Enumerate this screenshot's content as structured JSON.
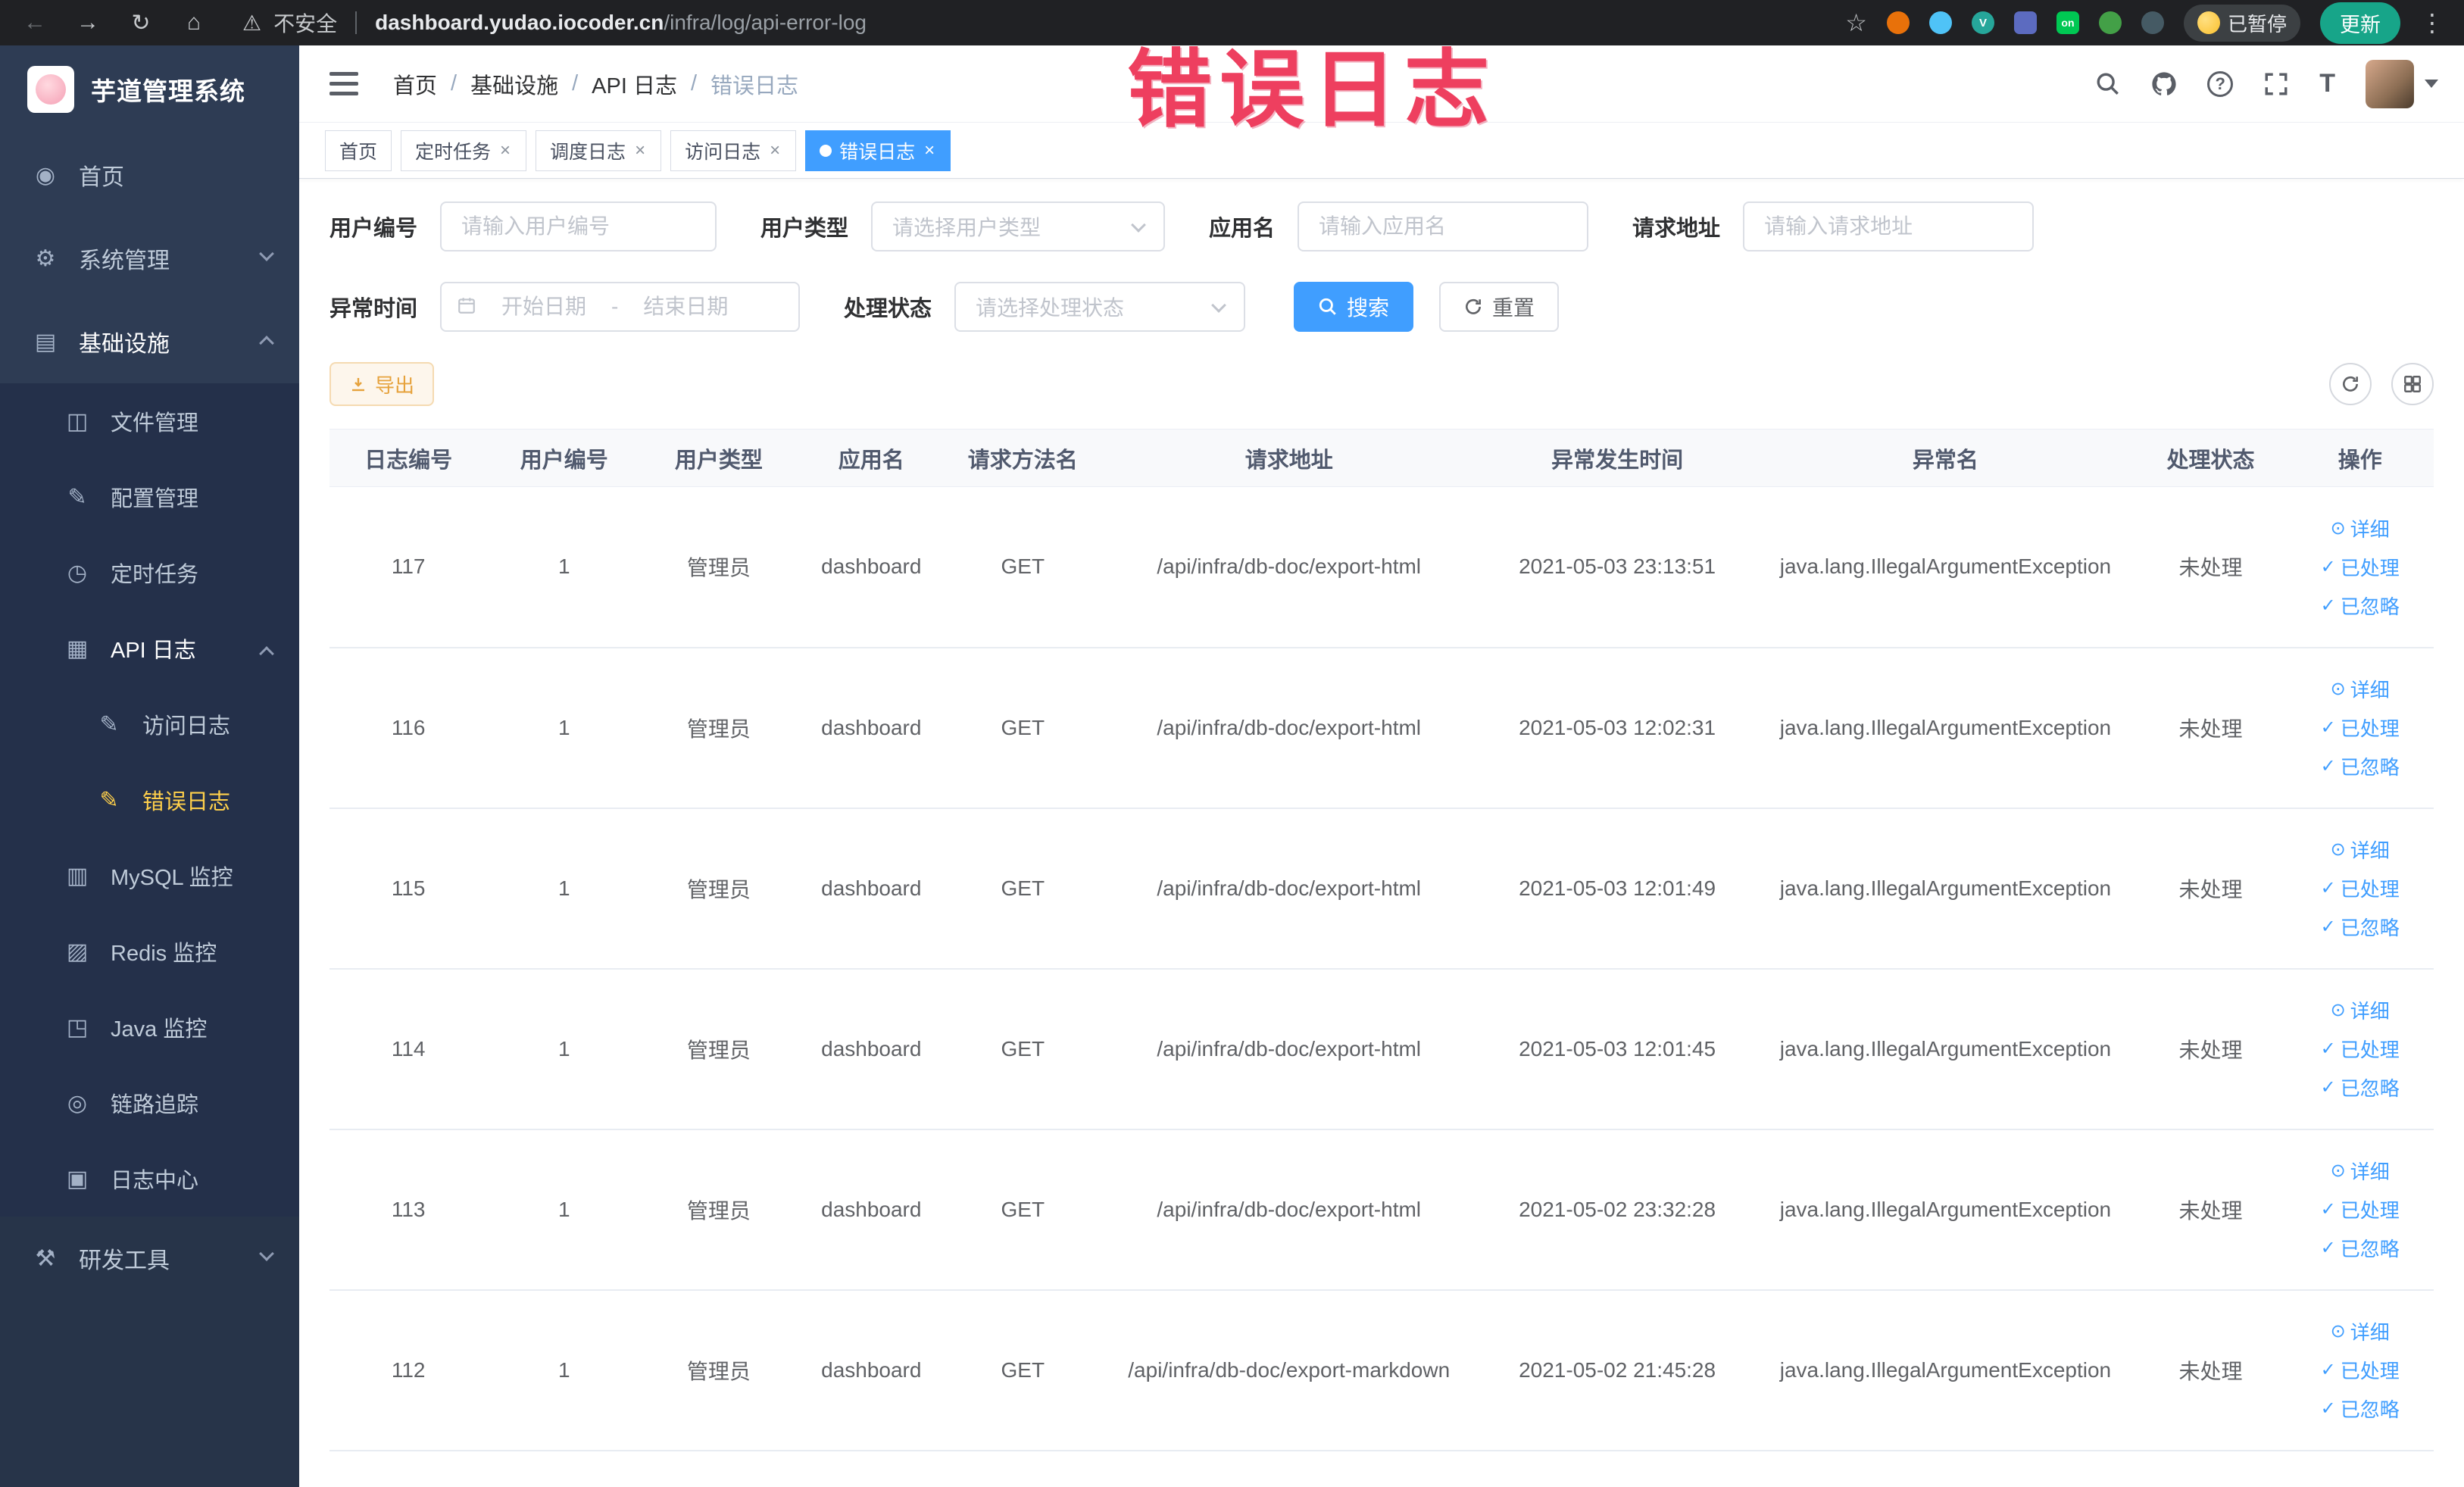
{
  "colors": {
    "accent": "#409EFF",
    "warning": "#e6a23c",
    "sidebar_active": "#ffd04b",
    "annotation": "#ee3f5f",
    "tag_active_bg": "#409EFF"
  },
  "icons": {
    "back": "←",
    "forward": "→",
    "reload": "↻",
    "browser_home": "⌂",
    "warning": "⚠",
    "star": "☆",
    "kebab": "⋮",
    "question": "?",
    "text_size": "T",
    "ext_v": "V",
    "ext_on": "on",
    "home": "◉",
    "system": "⚙",
    "infra": "▤",
    "file": "◫",
    "config": "✎",
    "job": "◷",
    "api_log": "▦",
    "access_log": "✎",
    "error_log": "✎",
    "mysql": "▥",
    "redis": "▨",
    "java": "◳",
    "trace": "◎",
    "log_center": "▣",
    "dev_tools": "⚒",
    "eye": "⊙",
    "check": "✓",
    "range_sep": "-"
  },
  "browser": {
    "security_label": "不安全",
    "url_domain": "dashboard.yudao.iocoder.cn",
    "url_path": "/infra/log/api-error-log",
    "paused_label": "已暂停",
    "update_label": "更新"
  },
  "annotation": {
    "text": "错误日志"
  },
  "sidebar": {
    "logo_title": "芋道管理系统",
    "items": {
      "home": "首页",
      "system": "系统管理",
      "infra": "基础设施",
      "file": "文件管理",
      "config": "配置管理",
      "job": "定时任务",
      "api_log": "API 日志",
      "access_log": "访问日志",
      "error_log": "错误日志",
      "mysql": "MySQL 监控",
      "redis": "Redis 监控",
      "java": "Java 监控",
      "trace": "链路追踪",
      "log_center": "日志中心",
      "dev_tools": "研发工具"
    }
  },
  "breadcrumb": {
    "items": [
      "首页",
      "基础设施",
      "API 日志",
      "错误日志"
    ]
  },
  "tabs": [
    {
      "label": "首页"
    },
    {
      "label": "定时任务"
    },
    {
      "label": "调度日志"
    },
    {
      "label": "访问日志"
    },
    {
      "label": "错误日志"
    }
  ],
  "filters": {
    "user_id": {
      "label": "用户编号",
      "placeholder": "请输入用户编号"
    },
    "user_type": {
      "label": "用户类型",
      "placeholder": "请选择用户类型"
    },
    "app_name": {
      "label": "应用名",
      "placeholder": "请输入应用名"
    },
    "request_url": {
      "label": "请求地址",
      "placeholder": "请输入请求地址"
    },
    "exception_time": {
      "label": "异常时间",
      "start_placeholder": "开始日期",
      "end_placeholder": "结束日期"
    },
    "process_status": {
      "label": "处理状态",
      "placeholder": "请选择处理状态"
    },
    "search_button": "搜索",
    "reset_button": "重置"
  },
  "toolbar": {
    "export_button": "导出"
  },
  "table": {
    "columns": [
      "日志编号",
      "用户编号",
      "用户类型",
      "应用名",
      "请求方法名",
      "请求地址",
      "异常发生时间",
      "异常名",
      "处理状态",
      "操作"
    ],
    "actions": {
      "detail": "详细",
      "processed": "已处理",
      "ignored": "已忽略"
    },
    "rows": [
      {
        "id": "117",
        "user_id": "1",
        "user_type": "管理员",
        "app": "dashboard",
        "method": "GET",
        "url": "/api/infra/db-doc/export-html",
        "time": "2021-05-03 23:13:51",
        "exception": "java.lang.IllegalArgumentException",
        "status": "未处理"
      },
      {
        "id": "116",
        "user_id": "1",
        "user_type": "管理员",
        "app": "dashboard",
        "method": "GET",
        "url": "/api/infra/db-doc/export-html",
        "time": "2021-05-03 12:02:31",
        "exception": "java.lang.IllegalArgumentException",
        "status": "未处理"
      },
      {
        "id": "115",
        "user_id": "1",
        "user_type": "管理员",
        "app": "dashboard",
        "method": "GET",
        "url": "/api/infra/db-doc/export-html",
        "time": "2021-05-03 12:01:49",
        "exception": "java.lang.IllegalArgumentException",
        "status": "未处理"
      },
      {
        "id": "114",
        "user_id": "1",
        "user_type": "管理员",
        "app": "dashboard",
        "method": "GET",
        "url": "/api/infra/db-doc/export-html",
        "time": "2021-05-03 12:01:45",
        "exception": "java.lang.IllegalArgumentException",
        "status": "未处理"
      },
      {
        "id": "113",
        "user_id": "1",
        "user_type": "管理员",
        "app": "dashboard",
        "method": "GET",
        "url": "/api/infra/db-doc/export-html",
        "time": "2021-05-02 23:32:28",
        "exception": "java.lang.IllegalArgumentException",
        "status": "未处理"
      },
      {
        "id": "112",
        "user_id": "1",
        "user_type": "管理员",
        "app": "dashboard",
        "method": "GET",
        "url": "/api/infra/db-doc/export-markdown",
        "time": "2021-05-02 21:45:28",
        "exception": "java.lang.IllegalArgumentException",
        "status": "未处理"
      }
    ]
  }
}
